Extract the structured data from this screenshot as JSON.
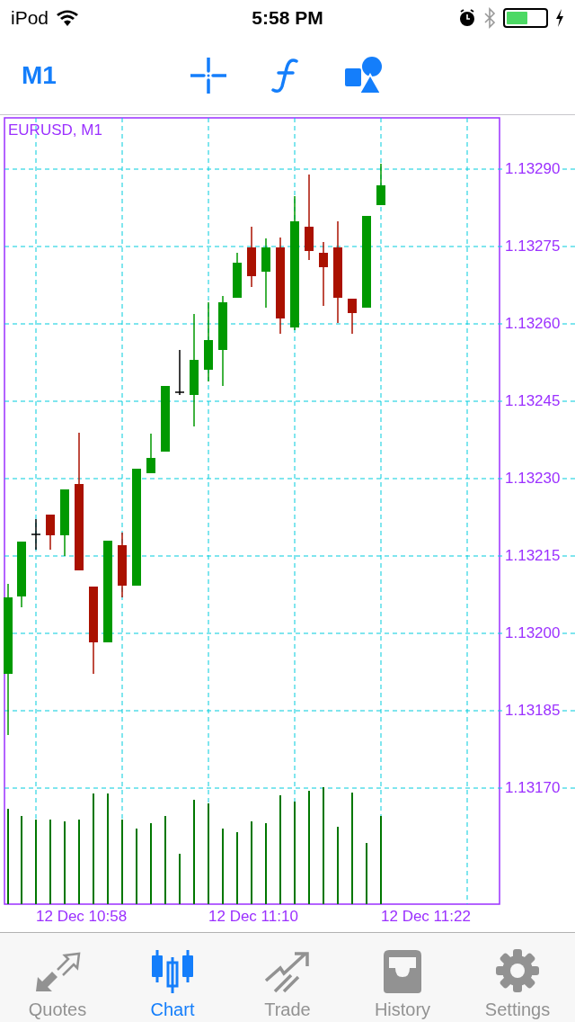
{
  "status_bar": {
    "device": "iPod",
    "time": "5:58 PM"
  },
  "toolbar": {
    "timeframe": "M1"
  },
  "chart": {
    "title": "EURUSD, M1",
    "price_labels": [
      "1.13290",
      "1.13275",
      "1.13260",
      "1.13245",
      "1.13230",
      "1.13215",
      "1.13200",
      "1.13185",
      "1.13170"
    ],
    "time_labels": [
      "12 Dec 10:58",
      "12 Dec 11:10",
      "12 Dec 11:22"
    ]
  },
  "tab_bar": [
    {
      "label": "Quotes",
      "selected": false
    },
    {
      "label": "Chart",
      "selected": true
    },
    {
      "label": "Trade",
      "selected": false
    },
    {
      "label": "History",
      "selected": false
    },
    {
      "label": "Settings",
      "selected": false
    }
  ]
}
